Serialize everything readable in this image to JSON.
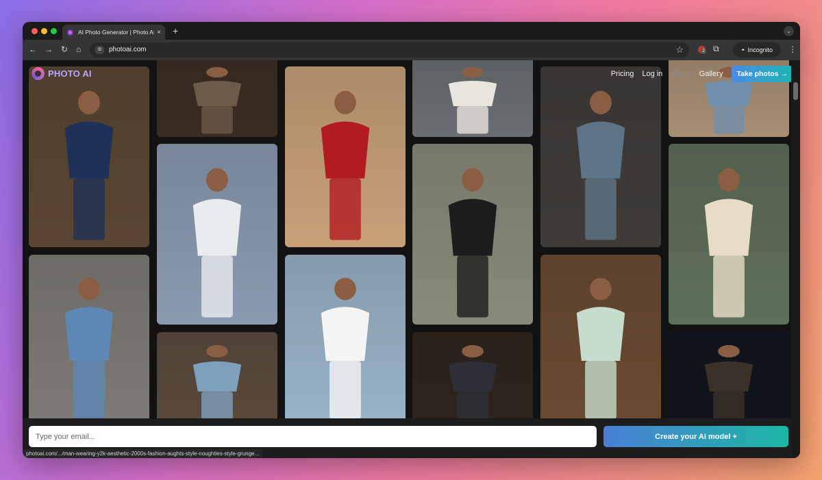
{
  "browser": {
    "tab_title": "AI Photo Generator | Photo AI",
    "tab_close": "×",
    "new_tab": "+",
    "url": "photoai.com",
    "incognito_label": "Incognito",
    "extension_badge": "2",
    "status_url": "photoai.com/.../man-wearing-y2k-aesthetic-2000s-fashion-aughts-style-noughties-style-grunge..."
  },
  "site": {
    "logo_text": "PHOTO AI",
    "nav": {
      "pricing": "Pricing",
      "login": "Log in",
      "billing": "Billing",
      "gallery": "Gallery",
      "take_photos": "Take photos →"
    },
    "email_placeholder": "Type your email...",
    "create_button": "Create your AI model +"
  },
  "gallery_tiles": [
    {
      "name": "man-navy-sherwani-photo",
      "bg": "#5a4632",
      "fg": "#1f3156"
    },
    {
      "name": "books-desk-photo",
      "bg": "#3a2c22",
      "fg": "#6d5a48"
    },
    {
      "name": "woman-white-crop-top-photo",
      "bg": "#c8a078",
      "fg": "#b11c22"
    },
    {
      "name": "white-jumpsuit-street-photo",
      "bg": "#6a6e72",
      "fg": "#e8e4de"
    },
    {
      "name": "man-black-tank-photo",
      "bg": "#3e3b39",
      "fg": "#5d7386"
    },
    {
      "name": "jeans-sneakers-photo",
      "bg": "#a88f74",
      "fg": "#6f8fab"
    },
    {
      "name": "man-white-tank-sea-photo",
      "bg": "#8a9ab0",
      "fg": "#e9ecef"
    },
    {
      "name": "woman-black-yellow-jacket-photo",
      "bg": "#8a8a7a",
      "fg": "#1d1d1d"
    },
    {
      "name": "blonde-woman-sweater-photo",
      "bg": "#5e6f5a",
      "fg": "#e8dcc6"
    },
    {
      "name": "man-white-crop-denim-photo",
      "bg": "#7e7b76",
      "fg": "#5d87b5"
    },
    {
      "name": "woman-blue-crop-top-photo",
      "bg": "#5a4a3c",
      "fg": "#7fa0bd"
    },
    {
      "name": "man-beach-palm-photo",
      "bg": "#9ab3c8",
      "fg": "#f5f5f5"
    },
    {
      "name": "man-pinstripe-suit-photo",
      "bg": "#2e241e",
      "fg": "#2d2e36"
    },
    {
      "name": "man-cafe-coffee-photo",
      "bg": "#6a4a32",
      "fg": "#c6dccc"
    },
    {
      "name": "night-crowd-festival-photo",
      "bg": "#10141c",
      "fg": "#3b3128"
    }
  ]
}
